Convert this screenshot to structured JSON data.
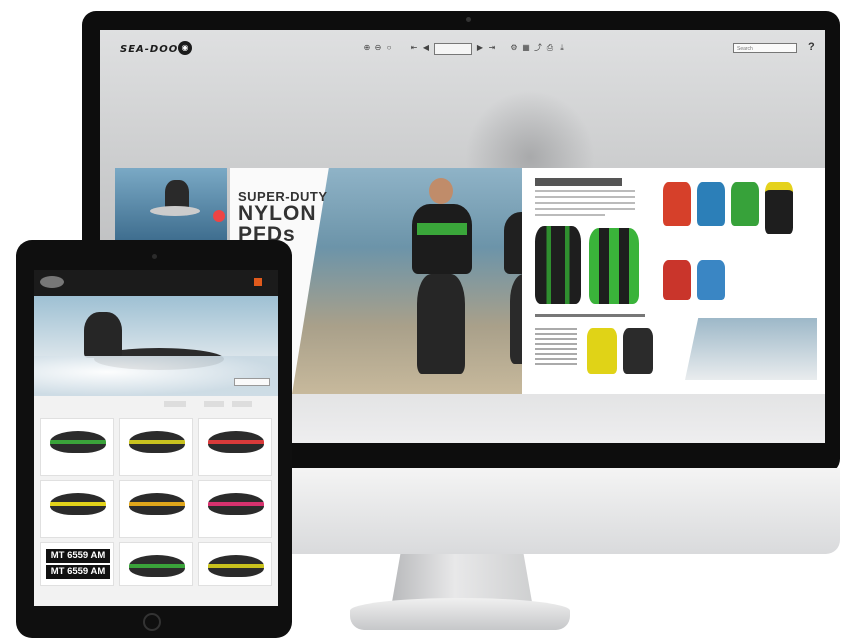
{
  "desktop": {
    "brand": "SEA-DOO",
    "page_indicator": "",
    "search_placeholder": "Search",
    "help_label": "?",
    "toolbar_icons": [
      "zoom-in-icon",
      "zoom-out-icon",
      "zoom-fit-icon",
      "first-page-icon",
      "prev-page-icon",
      "next-page-icon",
      "last-page-icon",
      "gear-icon",
      "grid-icon",
      "share-icon",
      "print-icon",
      "download-icon"
    ],
    "catalog": {
      "hero_line1": "SUPER-DUTY",
      "hero_line2": "NYLON",
      "hero_line3": "PFDs"
    }
  },
  "tablet": {
    "nav_items": [
      "",
      "",
      "",
      "",
      ""
    ],
    "products": [
      {
        "name": "",
        "color": "#3aa33a"
      },
      {
        "name": "",
        "color": "#c8c21f"
      },
      {
        "name": "",
        "color": "#d93a3a"
      },
      {
        "name": "",
        "color": "#e2d21a"
      },
      {
        "name": "",
        "color": "#e0a61b"
      },
      {
        "name": "",
        "color": "#d6326e"
      },
      {
        "plate1": "MT 6559 AM",
        "plate2": "MT 6559 AM"
      },
      {
        "name": "",
        "color": "#3aa33a"
      },
      {
        "name": "",
        "color": "#c9c21d"
      }
    ]
  },
  "colors": {
    "accent_orange": "#e05a1c",
    "frame": "#0d0d0d"
  }
}
